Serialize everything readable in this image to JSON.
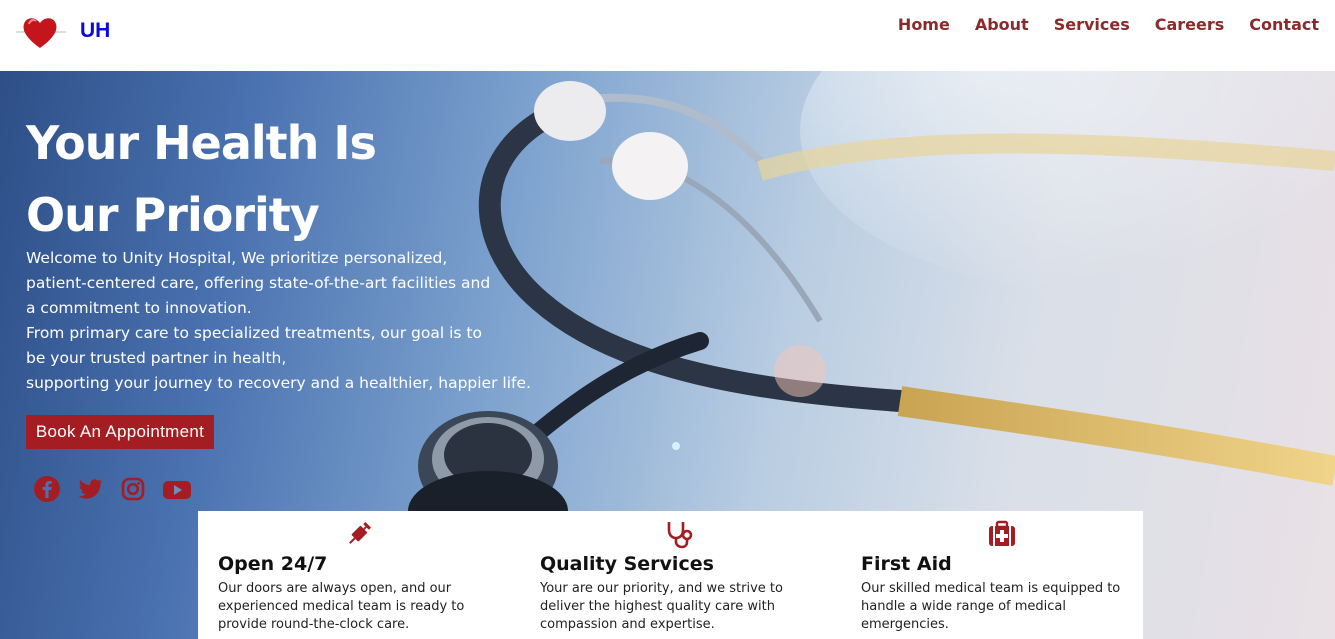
{
  "brand": {
    "name": "UH",
    "logo_icon": "heart-pulse-icon"
  },
  "nav": {
    "items": [
      "Home",
      "About",
      "Services",
      "Careers",
      "Contact"
    ]
  },
  "hero": {
    "title_line1": "Your Health Is",
    "title_line2": "Our Priority",
    "lines": [
      "Welcome to Unity Hospital, We prioritize personalized,",
      "patient-centered care, offering state-of-the-art facilities and",
      "a commitment to innovation.",
      "From primary care to specialized treatments, our goal is to",
      "be your trusted partner in health,",
      "supporting your journey to recovery and a healthier, happier life."
    ],
    "cta_label": "Book An Appointment",
    "socials": [
      "facebook-icon",
      "twitter-icon",
      "instagram-icon",
      "youtube-icon"
    ]
  },
  "features": [
    {
      "icon": "syringe-icon",
      "title": "Open 24/7",
      "text": "Our doors are always open, and our experienced medical team is ready to provide round-the-clock care."
    },
    {
      "icon": "stethoscope-icon",
      "title": "Quality Services",
      "text": "Your are our priority, and we strive to deliver the highest quality care with compassion and expertise."
    },
    {
      "icon": "first-aid-kit-icon",
      "title": "First Aid",
      "text": "Our skilled medical team is equipped to handle a wide range of medical emergencies."
    }
  ],
  "colors": {
    "accent": "#a31d22",
    "nav": "#8a2b2b",
    "brand": "#0a0ad8"
  }
}
